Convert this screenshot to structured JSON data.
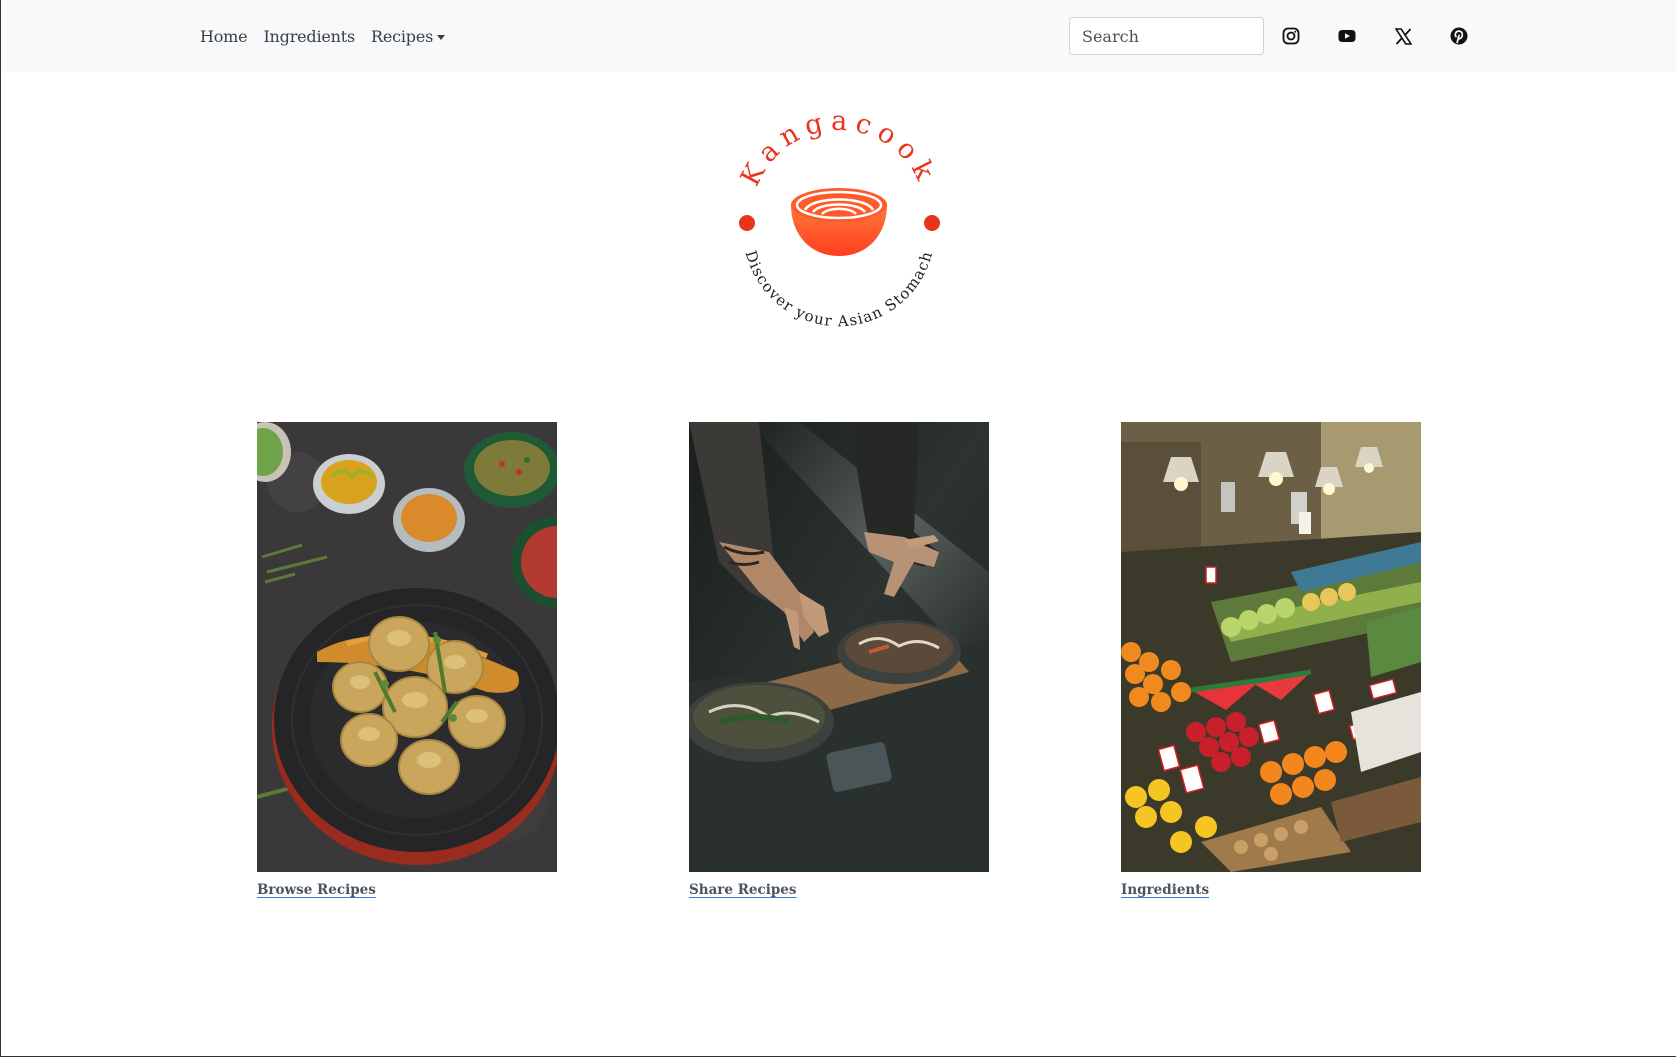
{
  "nav": {
    "items": [
      {
        "label": "Home"
      },
      {
        "label": "Ingredients"
      },
      {
        "label": "Recipes"
      }
    ],
    "search_placeholder": "Search",
    "social_icons": [
      "instagram-icon",
      "youtube-icon",
      "x-icon",
      "pinterest-icon"
    ]
  },
  "logo": {
    "brand": "Kangacook",
    "tagline": "Discover your Asian Stomach",
    "accent_color": "#e8341c",
    "gradient": [
      "#ff7a3d",
      "#ff3d1f"
    ]
  },
  "cards": [
    {
      "label": "Browse Recipes",
      "image": "dumplings-photo"
    },
    {
      "label": "Share Recipes",
      "image": "chef-plating-photo"
    },
    {
      "label": "Ingredients",
      "image": "produce-market-photo"
    }
  ]
}
